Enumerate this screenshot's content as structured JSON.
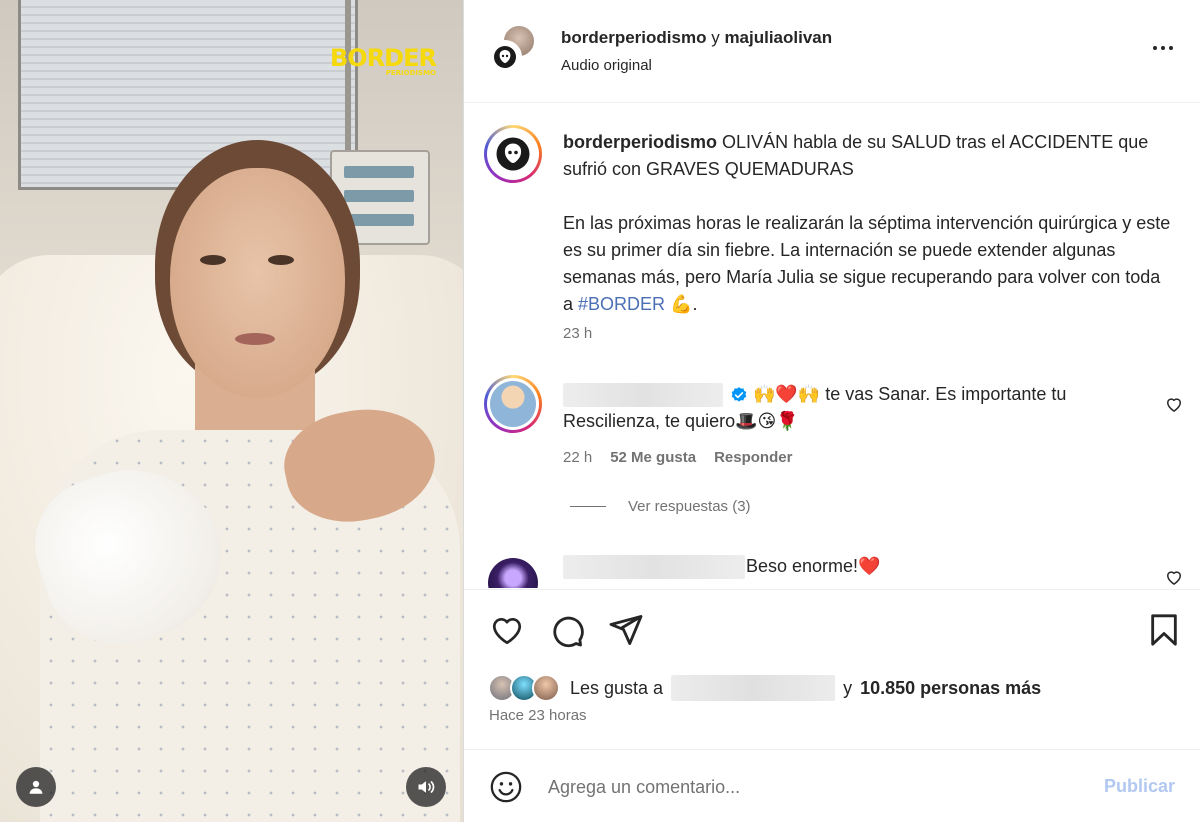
{
  "media": {
    "brand_logo": "BORDER",
    "brand_logo_sub": "PERIODISMO",
    "user_icon": "user-icon",
    "audio_icon": "volume-icon"
  },
  "header": {
    "owner_primary": "borderperiodismo",
    "owner_join": "y",
    "owner_secondary": "majuliaolivan",
    "audio_label": "Audio original",
    "more_icon": "more-options-icon"
  },
  "caption": {
    "username": "borderperiodismo",
    "line1": "OLIVÁN habla de su SALUD tras el ACCIDENTE que sufrió con GRAVES QUEMADURAS",
    "line2": "En las próximas horas le realizarán la séptima intervención quirúrgica y este es su primer día sin fiebre. La internación se puede extender algunas semanas más, pero María Julia se sigue recuperando para volver con toda a",
    "hashtag": "#BORDER",
    "emoji": "💪",
    "time": "23 h"
  },
  "comments": [
    {
      "text": "🙌❤️🙌 te vas Sanar. Es importante tu Rescilienza, te quiero🎩😘🌹",
      "time": "22 h",
      "likes": "52 Me gusta",
      "reply_label": "Responder",
      "view_replies": "Ver respuestas (3)"
    },
    {
      "text": "Beso enorme!❤️"
    }
  ],
  "actions": {
    "like_icon": "heart-icon",
    "comment_icon": "comment-icon",
    "share_icon": "send-icon",
    "save_icon": "bookmark-icon"
  },
  "likes": {
    "prefix": "Les gusta a",
    "suffix_join": "y",
    "count_text": "10.850 personas más",
    "posted_ago": "Hace 23 horas"
  },
  "add_comment": {
    "placeholder": "Agrega un comentario...",
    "post_label": "Publicar"
  },
  "colors": {
    "link_blue": "#4a6fb5",
    "publish_disabled": "#b2c8f0",
    "secondary_text": "#737373",
    "heart_red": "#ed4956"
  }
}
